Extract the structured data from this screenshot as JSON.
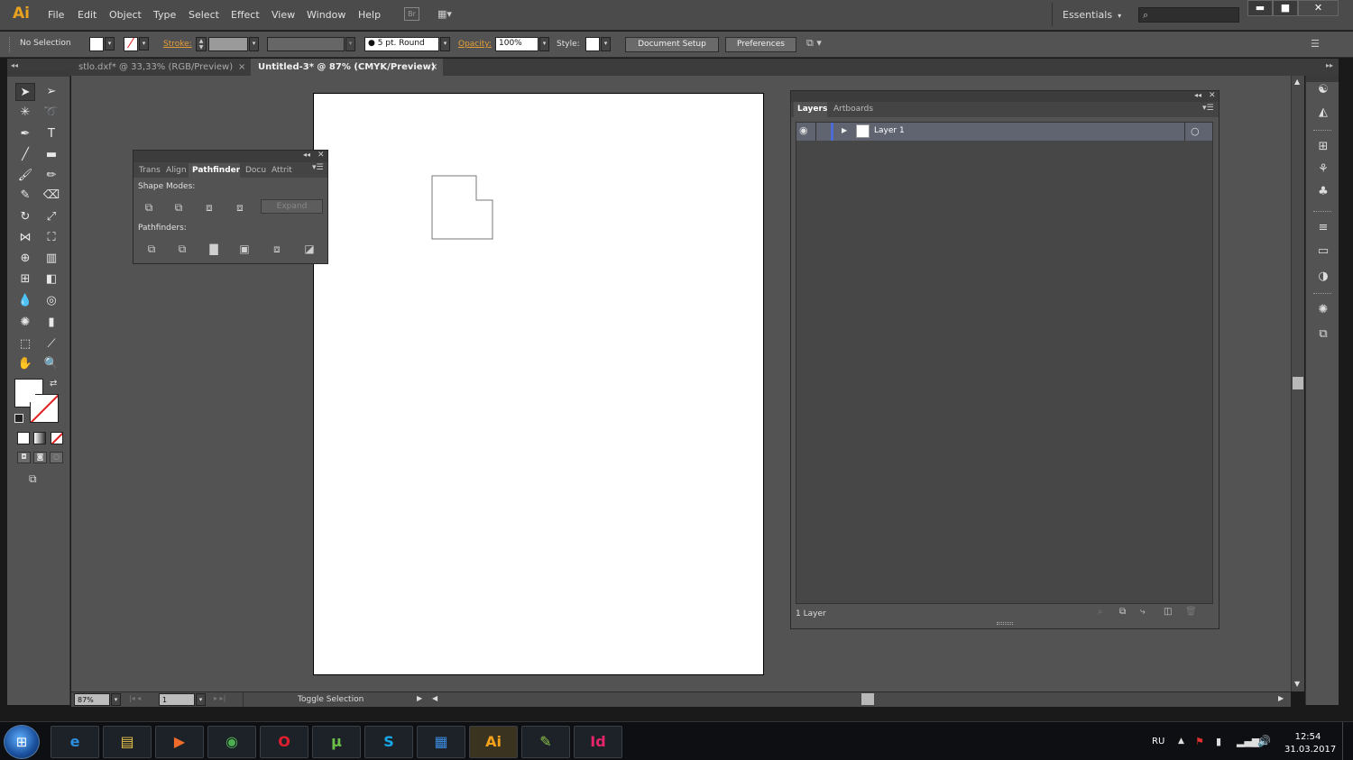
{
  "app": {
    "logo": "Ai",
    "menu": [
      "File",
      "Edit",
      "Object",
      "Type",
      "Select",
      "Effect",
      "View",
      "Window",
      "Help"
    ],
    "bridge_label": "Br",
    "workspace_name": "Essentials",
    "search_placeholder": "",
    "window_controls": {
      "minimize": "▬",
      "maximize": "■",
      "close": "✕"
    }
  },
  "control_bar": {
    "selection_label": "No Selection",
    "stroke_label": "Stroke:",
    "brush_value": "5 pt. Round",
    "opacity_label": "Opacity:",
    "opacity_value": "100%",
    "style_label": "Style:",
    "document_setup": "Document Setup",
    "preferences": "Preferences"
  },
  "documents": {
    "tabs": [
      {
        "label": "stlo.dxf* @ 33,33% (RGB/Preview)",
        "close": "×"
      },
      {
        "label": "Untitled-3* @ 87% (CMYK/Preview)",
        "close": "×"
      }
    ]
  },
  "pathfinder": {
    "tabs": [
      "Trans",
      "Align",
      "Pathfinder",
      "Docu",
      "Attrit"
    ],
    "shape_modes_label": "Shape Modes:",
    "pathfinders_label": "Pathfinders:",
    "expand_label": "Expand"
  },
  "layers": {
    "tabs": [
      "Layers",
      "Artboards"
    ],
    "layer_name": "Layer 1",
    "count_label": "1 Layer"
  },
  "status": {
    "zoom": "87%",
    "page": "1",
    "toggle_label": "Toggle Selection"
  },
  "taskbar": {
    "lang": "RU",
    "time": "12:54",
    "date": "31.03.2017",
    "apps": [
      {
        "name": "internet-explorer",
        "glyph": "e",
        "color": "#2b8fe0"
      },
      {
        "name": "file-explorer",
        "glyph": "▤",
        "color": "#e8c24a"
      },
      {
        "name": "media-player",
        "glyph": "▶",
        "color": "#f06c2a"
      },
      {
        "name": "chrome",
        "glyph": "◉",
        "color": "#4caf50"
      },
      {
        "name": "opera",
        "glyph": "O",
        "color": "#e0202e"
      },
      {
        "name": "utorrent",
        "glyph": "µ",
        "color": "#6cc04a"
      },
      {
        "name": "skype",
        "glyph": "S",
        "color": "#18a7e8"
      },
      {
        "name": "archive-tool",
        "glyph": "▦",
        "color": "#3b8be0"
      },
      {
        "name": "illustrator",
        "glyph": "Ai",
        "color": "#f4a21c"
      },
      {
        "name": "notepad-plus",
        "glyph": "✎",
        "color": "#8bc34a"
      },
      {
        "name": "indesign",
        "glyph": "Id",
        "color": "#e8246a"
      }
    ]
  }
}
